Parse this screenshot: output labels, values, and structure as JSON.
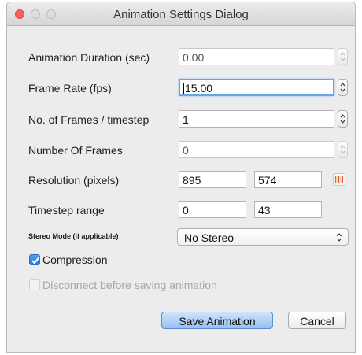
{
  "window": {
    "title": "Animation Settings Dialog"
  },
  "fields": {
    "duration": {
      "label": "Animation Duration (sec)",
      "value": "0.00"
    },
    "frame_rate": {
      "label": "Frame Rate (fps)",
      "value": "15.00"
    },
    "frames_per_timestep": {
      "label": "No. of Frames / timestep",
      "value": "1"
    },
    "number_of_frames": {
      "label": "Number Of Frames",
      "value": "0"
    },
    "resolution": {
      "label": "Resolution (pixels)",
      "width": "895",
      "height": "574"
    },
    "timestep_range": {
      "label": "Timestep range",
      "start": "0",
      "end": "43"
    },
    "stereo_mode": {
      "label": "Stereo Mode (if applicable)",
      "value": "No Stereo"
    }
  },
  "checkboxes": {
    "compression": {
      "label": "Compression",
      "checked": true
    },
    "disconnect": {
      "label": "Disconnect before saving animation",
      "checked": false,
      "enabled": false
    }
  },
  "buttons": {
    "save": "Save Animation",
    "cancel": "Cancel"
  },
  "colors": {
    "close_button": "#fc615d",
    "default_button": "#95c0f3",
    "focus_ring": "#6aa4e8",
    "checkbox_checked": "#2a79d8"
  },
  "icons": {
    "resolution_picker": "screen-size-icon"
  }
}
